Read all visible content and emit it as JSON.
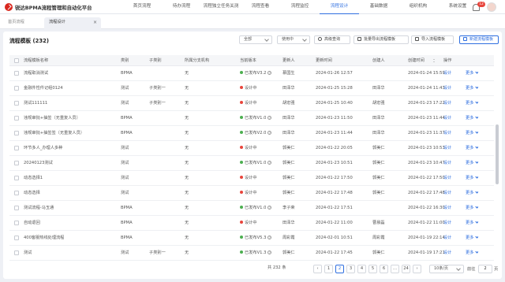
{
  "app": {
    "title": "锐达BPMA流程管理和自动化平台"
  },
  "nav": {
    "items": [
      "首页流程",
      "待办流程",
      "流程独立任务关测试",
      "流程查看",
      "流程监控",
      "流程设计",
      "基础数据",
      "组织机构",
      "系统设置"
    ],
    "active_index": 5,
    "notification_count": "12"
  },
  "tabs": [
    {
      "label": "首页流程"
    },
    {
      "label": "流程设计",
      "close": "×"
    }
  ],
  "panel": {
    "title": "流程模板 (232)",
    "filter1": "全部",
    "filter2": "使用中",
    "btn_advanced": "高级查询",
    "btn_export": "批量导出流程模板",
    "btn_import": "导入流程模板",
    "btn_new": "新建流程模板"
  },
  "table": {
    "columns": [
      "流程模板名称",
      "类别",
      "子类别",
      "所属分支机构",
      "当前版本",
      "更新人",
      "更新时间",
      "创建人",
      "创建时间",
      "操作"
    ],
    "rows": [
      {
        "name": "流程取消测试",
        "category": "BPMA",
        "sub": "",
        "branch": "无",
        "status": "已发布",
        "version": "V3.2",
        "status_color": "#4caf50",
        "updater": "慕国生",
        "updated": "2024-01-26 12:57",
        "creator": "",
        "created": "2024-01-24 15:59"
      },
      {
        "name": "金融件性件记组0124",
        "category": "测试",
        "sub": "子类别一",
        "branch": "无",
        "status": "设计中",
        "version": "",
        "status_color": "#e8453c",
        "updater": "田泽华",
        "updated": "2024-01-25 15:28",
        "creator": "田泽华",
        "created": "2024-01-24 11:43"
      },
      {
        "name": "测试111111",
        "category": "测试",
        "sub": "子类别一",
        "branch": "无",
        "status": "设计中",
        "version": "",
        "status_color": "#e8453c",
        "updater": "胡宏强",
        "updated": "2024-01-25 10:40",
        "creator": "胡宏强",
        "created": "2024-01-23 17:22"
      },
      {
        "name": "违规审批+抽签（无重复人员）",
        "category": "BPMA",
        "sub": "",
        "branch": "无",
        "status": "已发布",
        "version": "V1.0",
        "status_color": "#4caf50",
        "updater": "田泽华",
        "updated": "2024-01-23 11:50",
        "creator": "田泽华",
        "created": "2024-01-23 11:44"
      },
      {
        "name": "违规审批+抽签签（无重复人员）",
        "category": "BPMA",
        "sub": "",
        "branch": "无",
        "status": "已发布",
        "version": "V2.0",
        "status_color": "#4caf50",
        "updater": "田泽华",
        "updated": "2024-01-23 11:44",
        "creator": "田泽华",
        "created": "2024-01-23 11:37"
      },
      {
        "name": "环节多人_办理人多种",
        "category": "测试",
        "sub": "",
        "branch": "无",
        "status": "设计中",
        "version": "",
        "status_color": "#e8453c",
        "updater": "郭美仁",
        "updated": "2024-01-22 20:05",
        "creator": "郭美仁",
        "created": "2024-01-23 10:53"
      },
      {
        "name": "20240123测试",
        "category": "测试",
        "sub": "",
        "branch": "无",
        "status": "已发布",
        "version": "V1.0",
        "status_color": "#4caf50",
        "updater": "郭美仁",
        "updated": "2024-01-23 10:51",
        "creator": "郭美仁",
        "created": "2024-01-23 10:47"
      },
      {
        "name": "动态选择1",
        "category": "测试",
        "sub": "",
        "branch": "无",
        "status": "设计中",
        "version": "",
        "status_color": "#e8453c",
        "updater": "郭美仁",
        "updated": "2024-01-22 17:50",
        "creator": "郭美仁",
        "created": "2024-01-22 17:50"
      },
      {
        "name": "动态选择",
        "category": "测试",
        "sub": "",
        "branch": "无",
        "status": "设计中",
        "version": "",
        "status_color": "#e8453c",
        "updater": "郭美仁",
        "updated": "2024-01-22 17:48",
        "creator": "郭美仁",
        "created": "2024-01-22 17:48"
      },
      {
        "name": "测试流程-马玉通",
        "category": "BPMA",
        "sub": "",
        "branch": "无",
        "status": "已发布",
        "version": "V1.0",
        "status_color": "#4caf50",
        "updater": "李子荣",
        "updated": "2024-01-22 17:51",
        "creator": "",
        "created": "2024-01-22 16:30"
      },
      {
        "name": "自动退回",
        "category": "BPMA",
        "sub": "",
        "branch": "无",
        "status": "设计中",
        "version": "",
        "status_color": "#e8453c",
        "updater": "田泽华",
        "updated": "2024-01-22 11:00",
        "creator": "曹晨磊",
        "created": "2024-01-22 11:00"
      },
      {
        "name": "400客服热线处理流程",
        "category": "BPMA",
        "sub": "",
        "branch": "无",
        "status": "已发布",
        "version": "V5.3",
        "status_color": "#4caf50",
        "updater": "周彩霞",
        "updated": "2024-02-01 10:51",
        "creator": "周彩霞",
        "created": "2024-01-19 22:14"
      },
      {
        "name": "测试",
        "category": "测试",
        "sub": "子类别一",
        "branch": "无",
        "status": "已发布",
        "version": "V1.3",
        "status_color": "#4caf50",
        "updater": "郭美仁",
        "updated": "2024-01-22 17:45",
        "creator": "郭美仁",
        "created": "2024-01-19 17:21"
      }
    ],
    "action_design": "设计",
    "action_more": "更多"
  },
  "pagination": {
    "total": "共 232 条",
    "prev": "‹",
    "pages": [
      "1",
      "2",
      "3",
      "4",
      "5",
      "6",
      "…",
      "24"
    ],
    "current": "2",
    "next": "›",
    "page_size": "10条/页",
    "jump_label": "前往",
    "jump_value": "2",
    "jump_suffix": "页"
  }
}
